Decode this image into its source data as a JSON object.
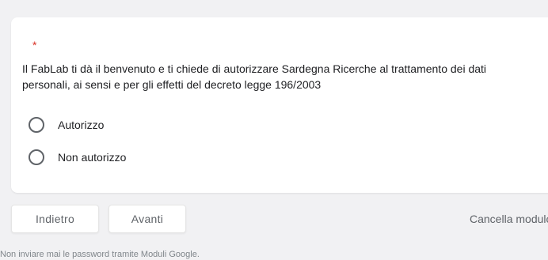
{
  "question": {
    "required_marker": "*",
    "text": "Il FabLab ti dà il benvenuto e ti chiede di autorizzare Sardegna Ricerche al trattamento dei dati personali, ai sensi e per gli effetti del decreto legge 196/2003",
    "options": [
      {
        "label": "Autorizzo",
        "selected": false
      },
      {
        "label": "Non autorizzo",
        "selected": false
      }
    ]
  },
  "navigation": {
    "back_label": "Indietro",
    "next_label": "Avanti",
    "clear_label": "Cancella modulo"
  },
  "footer": {
    "note": "Non inviare mai le password tramite Moduli Google."
  },
  "colors": {
    "background": "#f1f1f3",
    "required": "#d93025",
    "muted_text": "#5f6368"
  }
}
